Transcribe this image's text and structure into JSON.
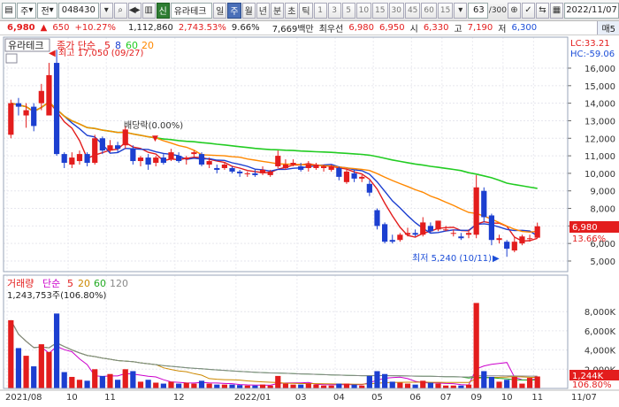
{
  "toolbar": {
    "market_select": "주",
    "market_select2": "전",
    "stock_code": "048430",
    "stock_badge": "신",
    "stock_name": "유라테크",
    "periods": [
      "일",
      "주",
      "월",
      "년",
      "분",
      "초",
      "틱"
    ],
    "active_period": "주",
    "numbers": [
      "1",
      "3",
      "5",
      "10",
      "15",
      "30",
      "45",
      "60",
      "15"
    ],
    "count_display": "63",
    "count_total": "/300",
    "date": "2022/11/07",
    "tab_label": "매5"
  },
  "infobar": {
    "price": "6,980",
    "change_arrow": "▲",
    "change": "650",
    "change_pct": "+10.27%",
    "volume": "1,112,860",
    "vol_ratio": "2,743.53%",
    "turnover": "9.66%",
    "amount": "7,669백만",
    "ask_label": "최우선",
    "ask": "6,980",
    "bid": "6,950",
    "open_label": "시",
    "open": "6,330",
    "high_label": "고",
    "high": "7,190",
    "low_label": "저",
    "low": "6,300",
    "tab_label": "매5"
  },
  "price_panel": {
    "title": "유라테크",
    "ma_label": "종가 단순",
    "ma_periods": [
      "5",
      "8",
      "60",
      "20"
    ],
    "ma_colors": [
      "#e31d1d",
      "#1c3fd0",
      "#22cc22",
      "#ff8800"
    ],
    "lc_text": "LC:33.21",
    "hc_text": "HC:-59.06",
    "high_annot": "최고 17,050 (09/27)",
    "low_annot": "최저 5,240 (10/11)",
    "dividend_annot": "배당락(0.00%)",
    "last_price_tag": "6,980",
    "last_pct_tag": "13.66%",
    "y_ticks": [
      "16,000",
      "15,000",
      "14,000",
      "13,000",
      "12,000",
      "11,000",
      "10,000",
      "9,000",
      "8,000",
      "7,000",
      "6,000",
      "5,000"
    ]
  },
  "volume_panel": {
    "title": "거래량",
    "ma_label": "단순",
    "ma_periods": [
      "5",
      "20",
      "60",
      "120"
    ],
    "ma_colors": [
      "#e31d1d",
      "#cc00cc",
      "#cc8800",
      "#22aa22",
      "#888888"
    ],
    "value_text": "1,243,753주(106.80%)",
    "y_ticks": [
      "8,000K",
      "6,000K",
      "4,000K",
      "2,000K"
    ],
    "last_vol_tag": "1,244K",
    "last_pct_tag": "106.80%"
  },
  "x_axis": {
    "labels": [
      "2021/08",
      "10",
      "11",
      "12",
      "2022/01",
      "03",
      "04",
      "05",
      "06",
      "07",
      "09",
      "10",
      "11",
      "11/07"
    ]
  },
  "chart_data": {
    "type": "candlestick",
    "unit_price": "KRW",
    "unit_volume": "shares",
    "candles": [
      {
        "o": 12200,
        "c": 14000,
        "h": 14200,
        "l": 12000,
        "v": 7100000
      },
      {
        "o": 14000,
        "c": 13800,
        "h": 14300,
        "l": 13300,
        "v": 4200000
      },
      {
        "o": 13300,
        "c": 13600,
        "h": 14000,
        "l": 12600,
        "v": 3400000
      },
      {
        "o": 13800,
        "c": 12700,
        "h": 14000,
        "l": 12400,
        "v": 2300000
      },
      {
        "o": 14000,
        "c": 14700,
        "h": 15100,
        "l": 13600,
        "v": 4600000
      },
      {
        "o": 13300,
        "c": 15600,
        "h": 16300,
        "l": 13300,
        "v": 3800000
      },
      {
        "o": 16300,
        "c": 11100,
        "h": 17050,
        "l": 11000,
        "v": 7800000
      },
      {
        "o": 11100,
        "c": 10600,
        "h": 11200,
        "l": 10300,
        "v": 1700000
      },
      {
        "o": 10500,
        "c": 10900,
        "h": 11200,
        "l": 10300,
        "v": 1200000
      },
      {
        "o": 10700,
        "c": 11100,
        "h": 11300,
        "l": 10500,
        "v": 900000
      },
      {
        "o": 11100,
        "c": 10600,
        "h": 11200,
        "l": 10400,
        "v": 800000
      },
      {
        "o": 10600,
        "c": 12000,
        "h": 12200,
        "l": 10500,
        "v": 2000000
      },
      {
        "o": 12000,
        "c": 11300,
        "h": 12100,
        "l": 11100,
        "v": 1300000
      },
      {
        "o": 11300,
        "c": 11600,
        "h": 11900,
        "l": 11200,
        "v": 1500000
      },
      {
        "o": 11600,
        "c": 11400,
        "h": 11800,
        "l": 11200,
        "v": 900000
      },
      {
        "o": 11600,
        "c": 12500,
        "h": 12700,
        "l": 11400,
        "v": 2000000
      },
      {
        "o": 11400,
        "c": 10700,
        "h": 11600,
        "l": 10500,
        "v": 1800000
      },
      {
        "o": 10700,
        "c": 10900,
        "h": 11000,
        "l": 10400,
        "v": 700000
      },
      {
        "o": 10900,
        "c": 10500,
        "h": 11100,
        "l": 10200,
        "v": 900000
      },
      {
        "o": 10600,
        "c": 10900,
        "h": 11000,
        "l": 10400,
        "v": 600000
      },
      {
        "o": 10900,
        "c": 10600,
        "h": 11100,
        "l": 10500,
        "v": 500000
      },
      {
        "o": 10800,
        "c": 11200,
        "h": 11400,
        "l": 10700,
        "v": 700000
      },
      {
        "o": 11000,
        "c": 10700,
        "h": 11200,
        "l": 10600,
        "v": 500000
      },
      {
        "o": 10800,
        "c": 10900,
        "h": 11000,
        "l": 10500,
        "v": 600000
      },
      {
        "o": 11100,
        "c": 11200,
        "h": 11300,
        "l": 10900,
        "v": 500000
      },
      {
        "o": 11100,
        "c": 10500,
        "h": 11200,
        "l": 10400,
        "v": 800000
      },
      {
        "o": 10500,
        "c": 10700,
        "h": 10900,
        "l": 10300,
        "v": 500000
      },
      {
        "o": 10300,
        "c": 10200,
        "h": 10500,
        "l": 10000,
        "v": 400000
      },
      {
        "o": 10300,
        "c": 10500,
        "h": 10600,
        "l": 10200,
        "v": 400000
      },
      {
        "o": 10300,
        "c": 10100,
        "h": 10400,
        "l": 10000,
        "v": 400000
      },
      {
        "o": 10100,
        "c": 10000,
        "h": 10200,
        "l": 9800,
        "v": 350000
      },
      {
        "o": 10000,
        "c": 10000,
        "h": 10100,
        "l": 9800,
        "v": 300000
      },
      {
        "o": 10000,
        "c": 9900,
        "h": 10200,
        "l": 9800,
        "v": 300000
      },
      {
        "o": 10000,
        "c": 10200,
        "h": 10400,
        "l": 9900,
        "v": 400000
      },
      {
        "o": 9900,
        "c": 10100,
        "h": 10200,
        "l": 9800,
        "v": 300000
      },
      {
        "o": 10400,
        "c": 11000,
        "h": 11300,
        "l": 10300,
        "v": 1300000
      },
      {
        "o": 10300,
        "c": 10500,
        "h": 10800,
        "l": 10200,
        "v": 500000
      },
      {
        "o": 10500,
        "c": 10600,
        "h": 10800,
        "l": 10400,
        "v": 400000
      },
      {
        "o": 10400,
        "c": 10200,
        "h": 10600,
        "l": 10100,
        "v": 400000
      },
      {
        "o": 10300,
        "c": 10500,
        "h": 10700,
        "l": 10100,
        "v": 500000
      },
      {
        "o": 10300,
        "c": 10500,
        "h": 10600,
        "l": 10200,
        "v": 400000
      },
      {
        "o": 10300,
        "c": 10400,
        "h": 10500,
        "l": 10100,
        "v": 300000
      },
      {
        "o": 10200,
        "c": 10400,
        "h": 10500,
        "l": 10100,
        "v": 300000
      },
      {
        "o": 10300,
        "c": 9800,
        "h": 10400,
        "l": 9600,
        "v": 500000
      },
      {
        "o": 9500,
        "c": 10100,
        "h": 10200,
        "l": 9400,
        "v": 500000
      },
      {
        "o": 10000,
        "c": 9700,
        "h": 10200,
        "l": 9500,
        "v": 400000
      },
      {
        "o": 9700,
        "c": 9800,
        "h": 9900,
        "l": 9500,
        "v": 300000
      },
      {
        "o": 9400,
        "c": 8900,
        "h": 9600,
        "l": 8700,
        "v": 1300000
      },
      {
        "o": 7900,
        "c": 7000,
        "h": 8000,
        "l": 6800,
        "v": 1800000
      },
      {
        "o": 7100,
        "c": 6100,
        "h": 7200,
        "l": 6000,
        "v": 1500000
      },
      {
        "o": 6200,
        "c": 6100,
        "h": 6500,
        "l": 6000,
        "v": 700000
      },
      {
        "o": 6200,
        "c": 6500,
        "h": 6600,
        "l": 6100,
        "v": 600000
      },
      {
        "o": 6500,
        "c": 6600,
        "h": 6900,
        "l": 6400,
        "v": 500000
      },
      {
        "o": 6600,
        "c": 6500,
        "h": 6800,
        "l": 6400,
        "v": 400000
      },
      {
        "o": 6500,
        "c": 7200,
        "h": 7500,
        "l": 6400,
        "v": 800000
      },
      {
        "o": 7000,
        "c": 6700,
        "h": 7200,
        "l": 6600,
        "v": 600000
      },
      {
        "o": 6800,
        "c": 7300,
        "h": 7300,
        "l": 6700,
        "v": 500000
      },
      {
        "o": 6800,
        "c": 6800,
        "h": 7000,
        "l": 6700,
        "v": 300000
      },
      {
        "o": 6600,
        "c": 6600,
        "h": 6800,
        "l": 6400,
        "v": 300000
      },
      {
        "o": 6400,
        "c": 6300,
        "h": 6600,
        "l": 6200,
        "v": 300000
      },
      {
        "o": 6500,
        "c": 6600,
        "h": 6800,
        "l": 6300,
        "v": 400000
      },
      {
        "o": 6500,
        "c": 9200,
        "h": 9900,
        "l": 6300,
        "v": 8900000
      },
      {
        "o": 9000,
        "c": 7500,
        "h": 9200,
        "l": 7200,
        "v": 1800000
      },
      {
        "o": 7600,
        "c": 6200,
        "h": 7700,
        "l": 5900,
        "v": 1200000
      },
      {
        "o": 6200,
        "c": 6300,
        "h": 6500,
        "l": 6000,
        "v": 700000
      },
      {
        "o": 6100,
        "c": 5700,
        "h": 6200,
        "l": 5240,
        "v": 900000
      },
      {
        "o": 5600,
        "c": 6100,
        "h": 6400,
        "l": 5500,
        "v": 1200000
      },
      {
        "o": 6000,
        "c": 6400,
        "h": 6500,
        "l": 5900,
        "v": 500000
      },
      {
        "o": 6300,
        "c": 6300,
        "h": 6500,
        "l": 6100,
        "v": 1100000
      },
      {
        "o": 6330,
        "c": 6980,
        "h": 7190,
        "l": 6300,
        "v": 1243753
      }
    ],
    "y_range": [
      4800,
      17200
    ],
    "volume_range": [
      0,
      9400000
    ]
  }
}
